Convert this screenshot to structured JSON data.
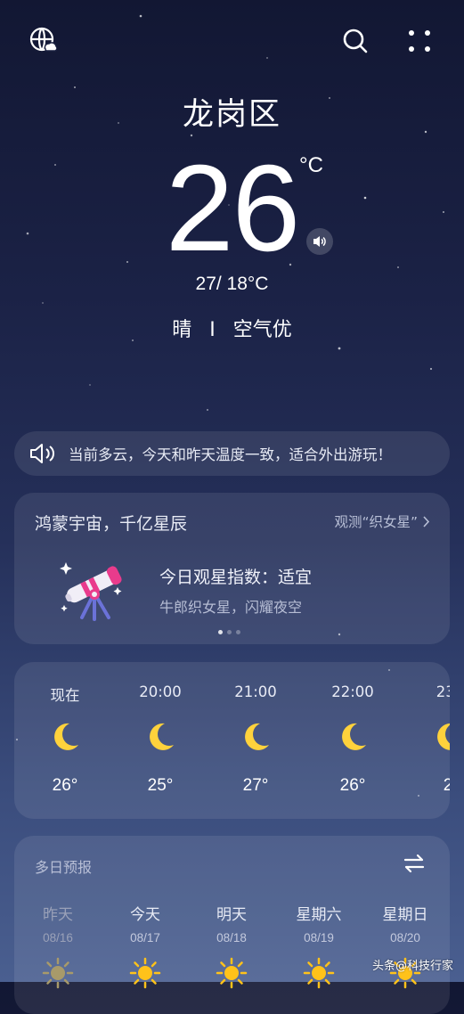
{
  "location": {
    "city": "龙岗区"
  },
  "current": {
    "temperature": "26",
    "unit": "°C",
    "range": "27/ 18°C",
    "condition": "晴",
    "separator": "I",
    "air_quality": "空气优"
  },
  "tip": {
    "text": "当前多云，今天和昨天温度一致，适合外出游玩！"
  },
  "stargazing": {
    "title": "鸿蒙宇宙，千亿星辰",
    "link_label": "观测“织女星”",
    "index_label": "今日观星指数：适宜",
    "subtitle": "牛郎织女星，闪耀夜空",
    "page_count": 3,
    "active_page": 1
  },
  "hourly": [
    {
      "time": "现在",
      "temp": "26°",
      "icon": "moon-icon"
    },
    {
      "time": "20:00",
      "temp": "25°",
      "icon": "moon-icon"
    },
    {
      "time": "21:00",
      "temp": "27°",
      "icon": "moon-icon"
    },
    {
      "time": "22:00",
      "temp": "26°",
      "icon": "moon-icon"
    },
    {
      "time": "23:",
      "temp": "2",
      "icon": "moon-icon"
    }
  ],
  "multi_day": {
    "title": "多日预报",
    "days": [
      {
        "name": "昨天",
        "date": "08/16",
        "icon": "sun-icon",
        "past": true
      },
      {
        "name": "今天",
        "date": "08/17",
        "icon": "sun-icon",
        "past": false
      },
      {
        "name": "明天",
        "date": "08/18",
        "icon": "sun-icon",
        "past": false
      },
      {
        "name": "星期六",
        "date": "08/19",
        "icon": "sun-icon",
        "past": false
      },
      {
        "name": "星期日",
        "date": "08/20",
        "icon": "sun-icon",
        "past": false
      }
    ]
  },
  "watermark": "头条@科技行家",
  "colors": {
    "moon": "#ffd23c",
    "sun": "#ffc21a",
    "telescope_pink": "#e93b8c"
  }
}
